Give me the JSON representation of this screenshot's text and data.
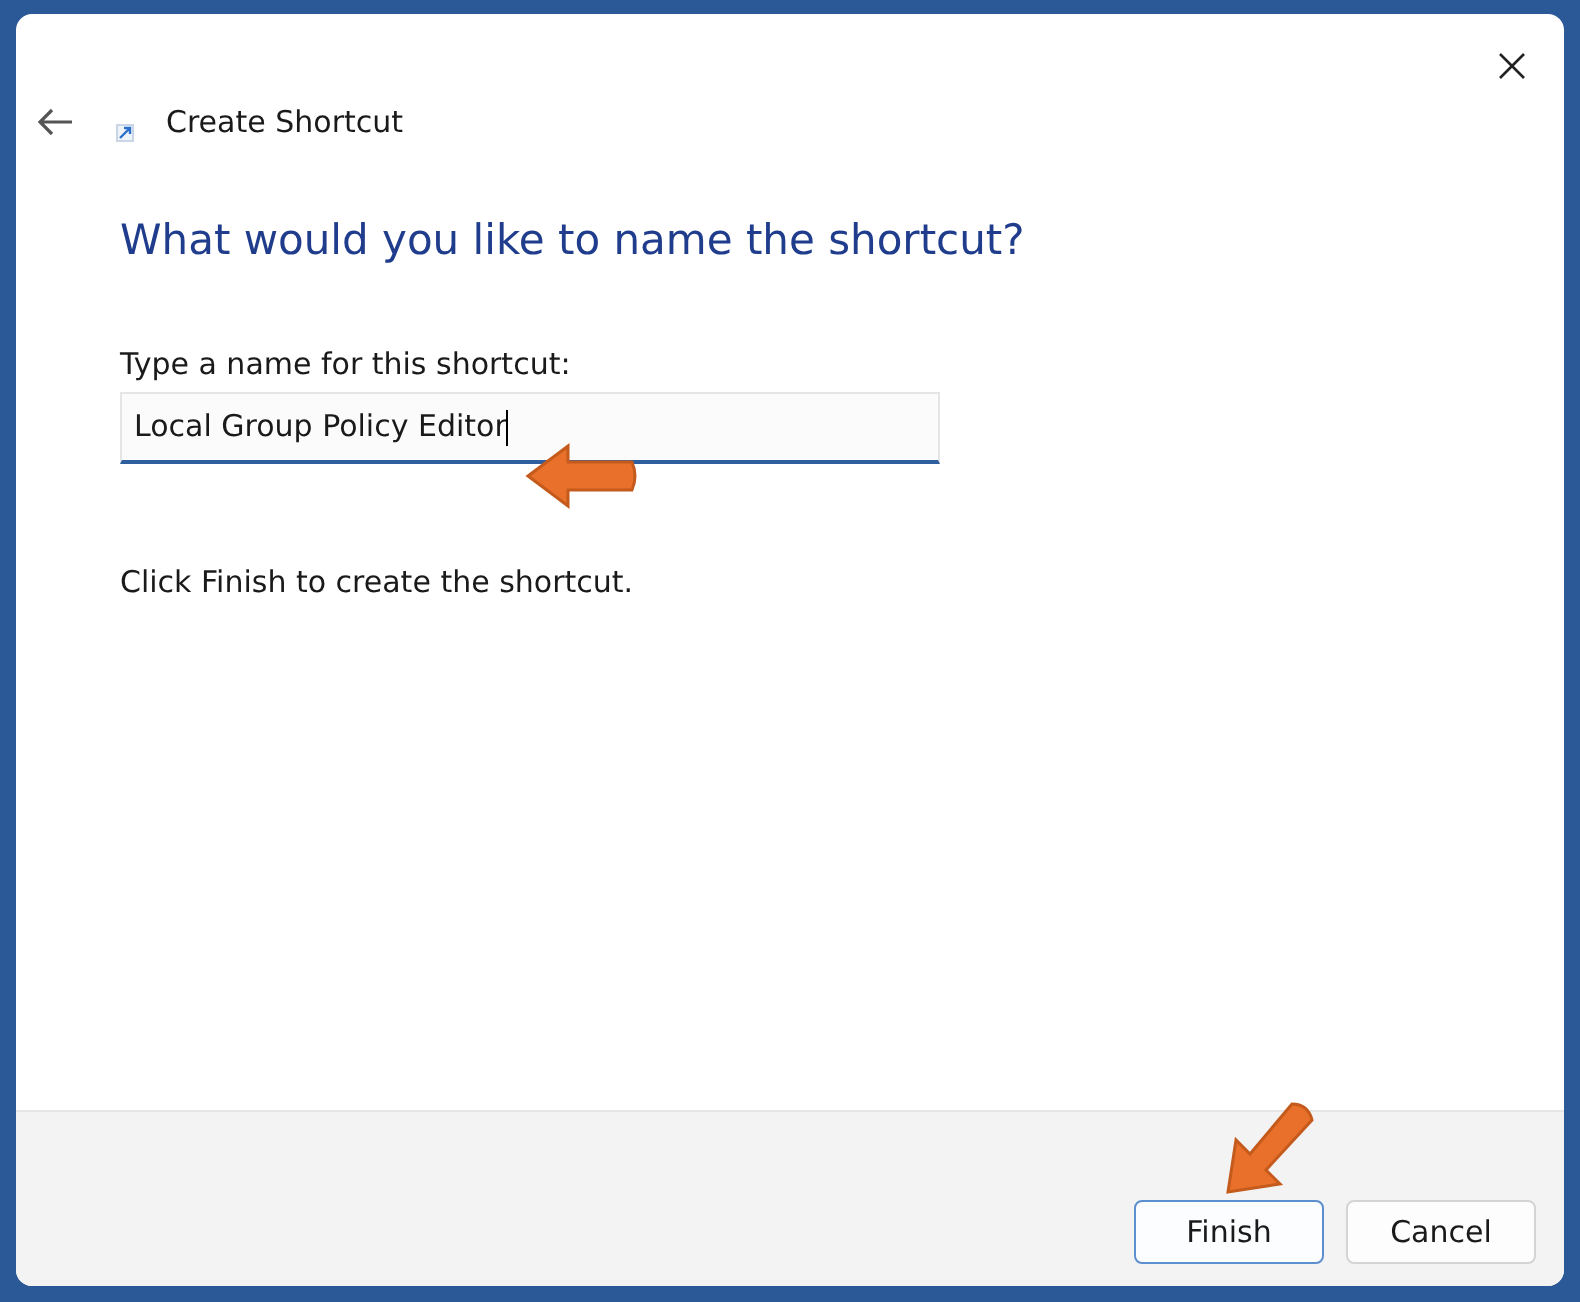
{
  "window": {
    "title": "Create Shortcut"
  },
  "heading": "What would you like to name the shortcut?",
  "name_field": {
    "label": "Type a name for this shortcut:",
    "value": "Local Group Policy Editor",
    "focused": true
  },
  "instruction": "Click Finish to create the shortcut.",
  "buttons": [
    {
      "label": "Finish",
      "default": true
    },
    {
      "label": "Cancel",
      "default": false
    }
  ]
}
